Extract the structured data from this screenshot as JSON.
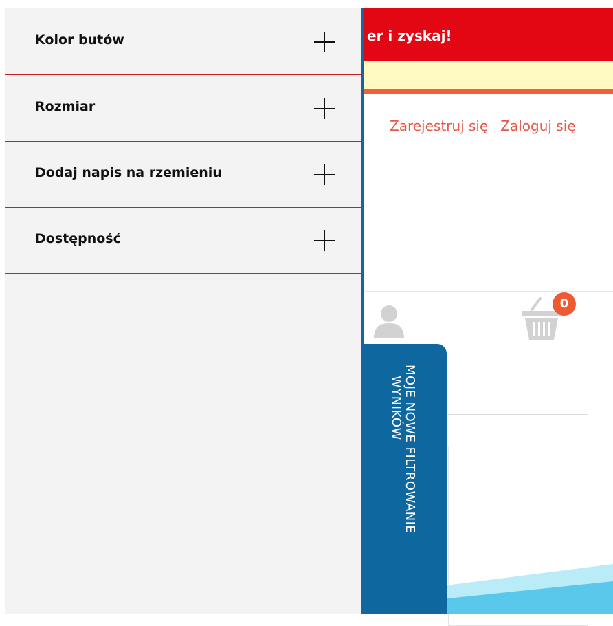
{
  "promo": {
    "text": "er i zyskaj!"
  },
  "auth": {
    "register_label": "Zarejestruj się",
    "login_label": "Zaloguj się"
  },
  "cart": {
    "count": "0"
  },
  "filters": [
    {
      "label": "Kolor butów",
      "icon": "plus-icon"
    },
    {
      "label": "Rozmiar",
      "icon": "plus-icon"
    },
    {
      "label": "Dodaj napis na rzemieniu",
      "icon": "plus-icon"
    },
    {
      "label": "Dostępność",
      "icon": "plus-icon"
    }
  ],
  "side_tab": {
    "line1": "MOJE NOWE FILTROWANIE",
    "line2": "WYNIKÓW"
  },
  "colors": {
    "promo_red": "#e30613",
    "notice_yellow": "#fffac2",
    "accent_orange": "#f0603a",
    "link_red": "#e35a4a",
    "tab_blue": "#0f67a0",
    "divider_red": "#cc1f1f",
    "panel_bg": "#f3f3f3"
  }
}
